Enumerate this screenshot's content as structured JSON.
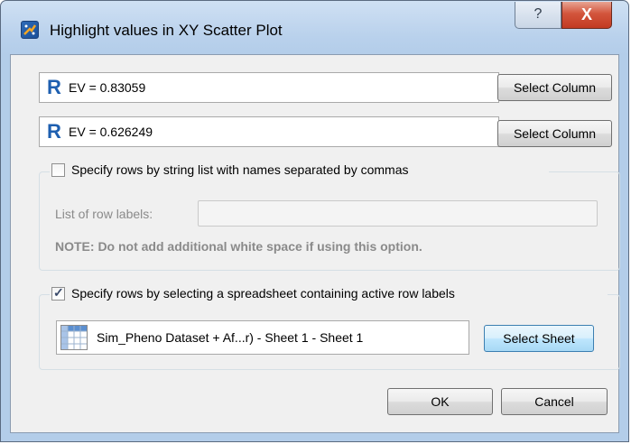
{
  "window": {
    "title": "Highlight values in XY Scatter Plot",
    "help_glyph": "?",
    "close_glyph": "X"
  },
  "expressions": [
    {
      "text": "EV = 0.83059",
      "icon": "R",
      "button": "Select Column"
    },
    {
      "text": "EV = 0.626249",
      "icon": "R",
      "button": "Select Column"
    }
  ],
  "string_list_option": {
    "checked": false,
    "label": "Specify rows by string list with names separated by commas",
    "field_label": "List of row labels:",
    "field_value": "",
    "note": "NOTE: Do not add additional white space if using this option."
  },
  "sheet_option": {
    "checked": true,
    "check_glyph": "✓",
    "label": "Specify rows by selecting a spreadsheet containing active row labels",
    "sheet_name": "Sim_Pheno Dataset + Af...r) - Sheet 1 - Sheet 1",
    "button": "Select Sheet"
  },
  "buttons": {
    "ok": "OK",
    "cancel": "Cancel"
  }
}
